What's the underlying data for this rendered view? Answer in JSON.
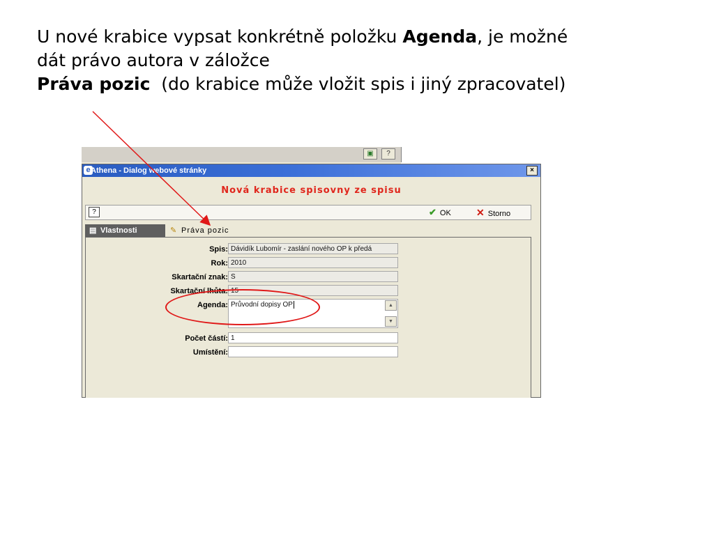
{
  "slide": {
    "line1_pre": "U nové krabice vypsat konkrétně položku ",
    "line1_bold": "Agenda",
    "line1_post": ", je možné",
    "line2": "dát právo autora v záložce",
    "line3_bold": "Práva pozic",
    "line3_post": "  (do krabice může vložit spis i jiný zpracovatel)"
  },
  "background_window": {
    "icons": [
      "export-icon",
      "help-icon"
    ],
    "help_glyph": "?"
  },
  "dialog": {
    "title": "Athena - Dialog webové stránky",
    "close_glyph": "×",
    "heading": "Nová krabice spisovny ze spisu",
    "help_glyph": "?",
    "ok_label": "OK",
    "cancel_label": "Storno"
  },
  "tabs": [
    {
      "label": "Vlastnosti",
      "active": true,
      "icon": "properties-icon"
    },
    {
      "label": "Práva pozic",
      "active": false,
      "icon": "permissions-icon"
    }
  ],
  "form": {
    "spis_label": "Spis:",
    "spis_value": "Dávidík Lubomír - zaslání nového OP k předá",
    "rok_label": "Rok:",
    "rok_value": "2010",
    "znak_label": "Skartační znak:",
    "znak_value": "S",
    "lhuta_label": "Skartační lhůta:",
    "lhuta_value": "15",
    "agenda_label": "Agenda:",
    "agenda_value": "Průvodní dopisy OP",
    "pocet_label": "Počet částí:",
    "pocet_value": "1",
    "umisteni_label": "Umístění:",
    "umisteni_value": ""
  },
  "annotation_colors": {
    "circle": "#e01818",
    "arrow": "#e01818"
  },
  "colors": {
    "title_bar": "#2a5cc0",
    "heading": "#e0261c",
    "dialog_bg": "#ece9d8"
  }
}
